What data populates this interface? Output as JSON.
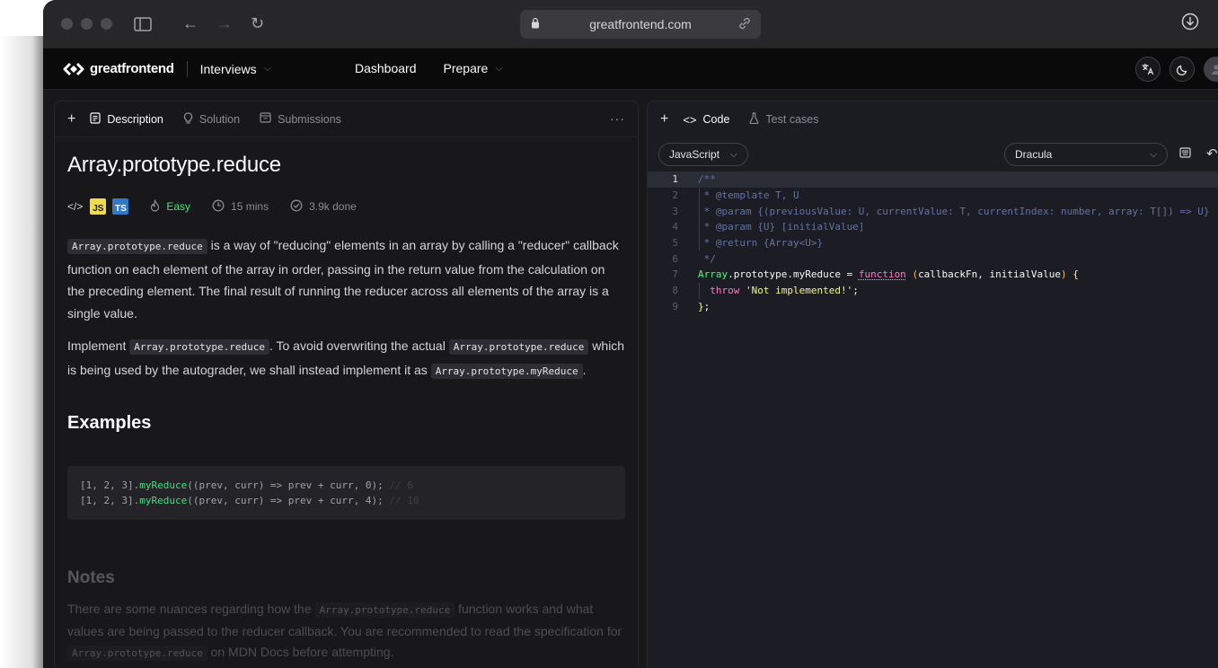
{
  "browser": {
    "url": "greatfrontend.com"
  },
  "nav": {
    "brand": "greatfrontend",
    "section": "Interviews",
    "links": [
      "Dashboard",
      "Prepare"
    ]
  },
  "left_panel": {
    "tabs": [
      "Description",
      "Solution",
      "Submissions"
    ],
    "title": "Array.prototype.reduce",
    "meta": {
      "js": "JS",
      "ts": "TS",
      "difficulty": "Easy",
      "duration": "15 mins",
      "done": "3.9k done"
    },
    "para1": {
      "code": "Array.prototype.reduce",
      "text": " is a way of \"reducing\" elements in an array by calling a \"reducer\" callback function on each element of the array in order, passing in the return value from the calculation on the preceding element. The final result of running the reducer across all elements of the array is a single value."
    },
    "para2": {
      "t1": "Implement ",
      "c1": "Array.prototype.reduce",
      "t2": ". To avoid overwriting the actual ",
      "c2": "Array.prototype.reduce",
      "t3": " which is being used by the autograder, we shall instead implement it as ",
      "c3": "Array.prototype.myReduce",
      "t4": "."
    },
    "examples_heading": "Examples",
    "examples": [
      {
        "pre": "[1, 2, 3].",
        "fn": "myReduce",
        "post": "((prev, curr) => prev + curr, 0); ",
        "comment": "// 6"
      },
      {
        "pre": "[1, 2, 3].",
        "fn": "myReduce",
        "post": "((prev, curr) => prev + curr, 4); ",
        "comment": "// 10"
      }
    ],
    "notes_heading": "Notes",
    "notes": {
      "t1": "There are some nuances regarding how the ",
      "c1": "Array.prototype.reduce",
      "t2": " function works and what values are being passed to the reducer callback. You are recommended to read the specification for ",
      "c2": "Array.prototype.reduce",
      "t3": " on MDN Docs before attempting."
    }
  },
  "right_panel": {
    "tabs": [
      "Code",
      "Test cases"
    ],
    "language": "JavaScript",
    "theme": "Dracula",
    "code_lines": [
      "1",
      "2",
      "3",
      "4",
      "5",
      "6",
      "7",
      "8",
      "9"
    ]
  }
}
